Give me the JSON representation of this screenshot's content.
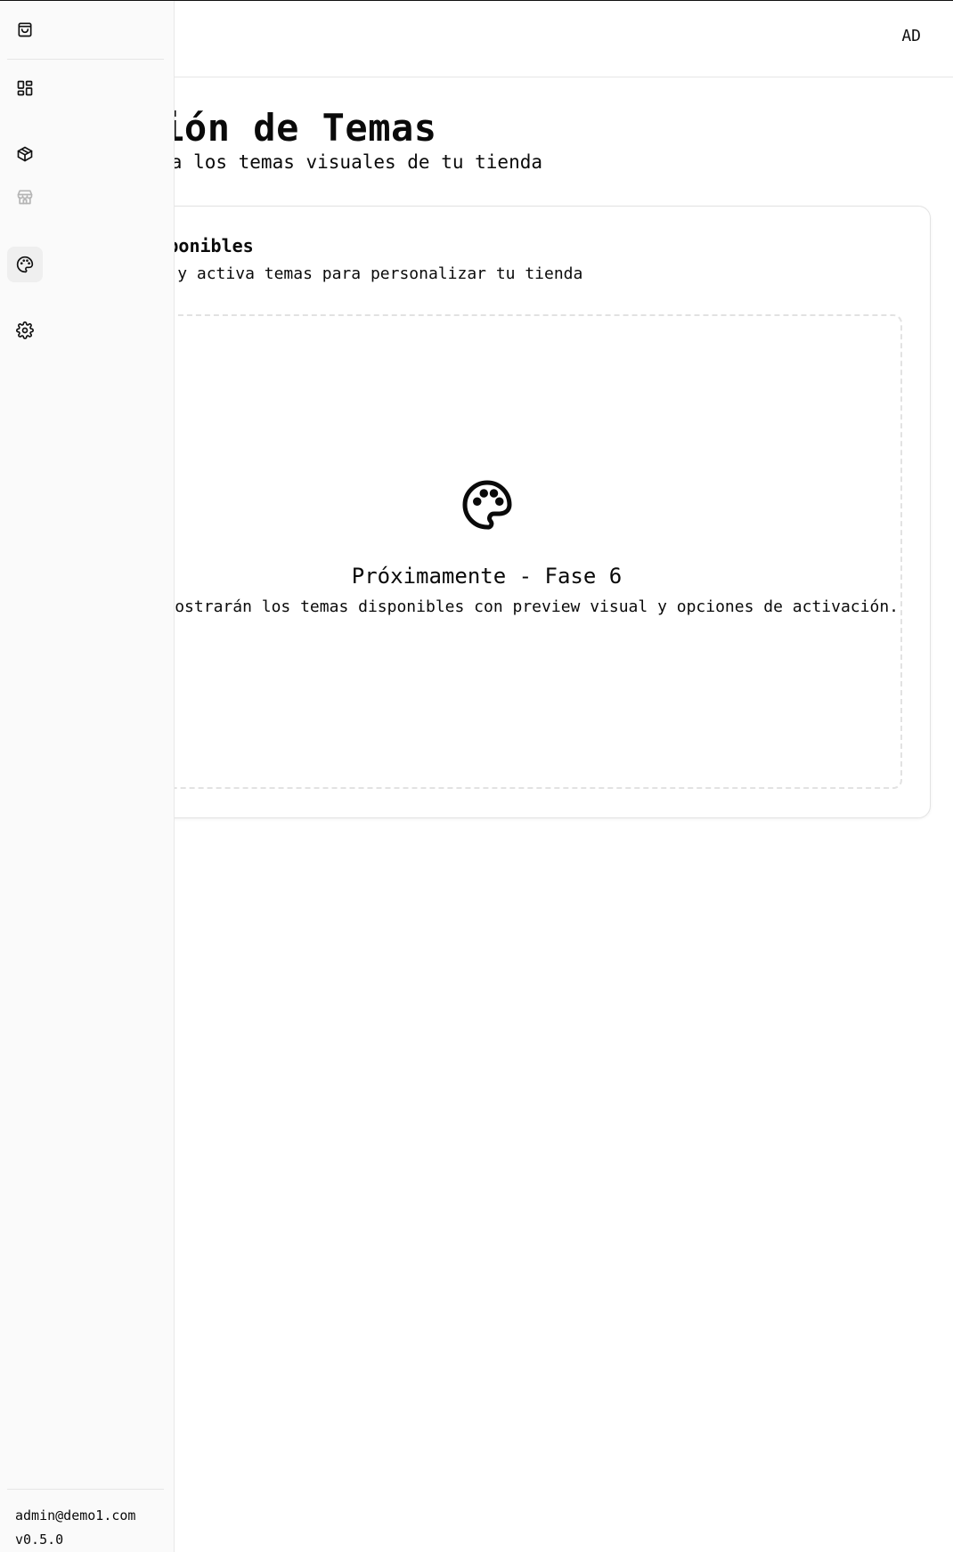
{
  "header": {
    "avatar_initials": "AD"
  },
  "page": {
    "title": "Gestión de Temas",
    "subtitle": "Administra los temas visuales de tu tienda"
  },
  "card": {
    "title": "Temas Disponibles",
    "description": "Selecciona y activa temas para personalizar tu tienda",
    "empty_state": {
      "icon": "palette-icon",
      "title": "Próximamente - Fase 6",
      "description": "Aquí se mostrarán los temas disponibles con preview visual y opciones de activación."
    }
  },
  "sidebar": {
    "items": [
      {
        "icon": "shopping-bag-icon",
        "state": "normal"
      },
      {
        "icon": "dashboard-icon",
        "state": "normal"
      },
      {
        "icon": "package-icon",
        "state": "normal"
      },
      {
        "icon": "store-icon",
        "state": "disabled"
      },
      {
        "icon": "palette-icon",
        "state": "active"
      },
      {
        "icon": "settings-gear-icon",
        "state": "normal"
      }
    ],
    "footer": {
      "email": "admin@demo1.com",
      "version": "v0.5.0"
    }
  },
  "colors": {
    "text": "#0a0a0a",
    "muted_icon": "#b5b5b5",
    "sidebar_bg": "#fafafa",
    "active_item_bg": "#efefef",
    "border": "#e3e3e3"
  }
}
